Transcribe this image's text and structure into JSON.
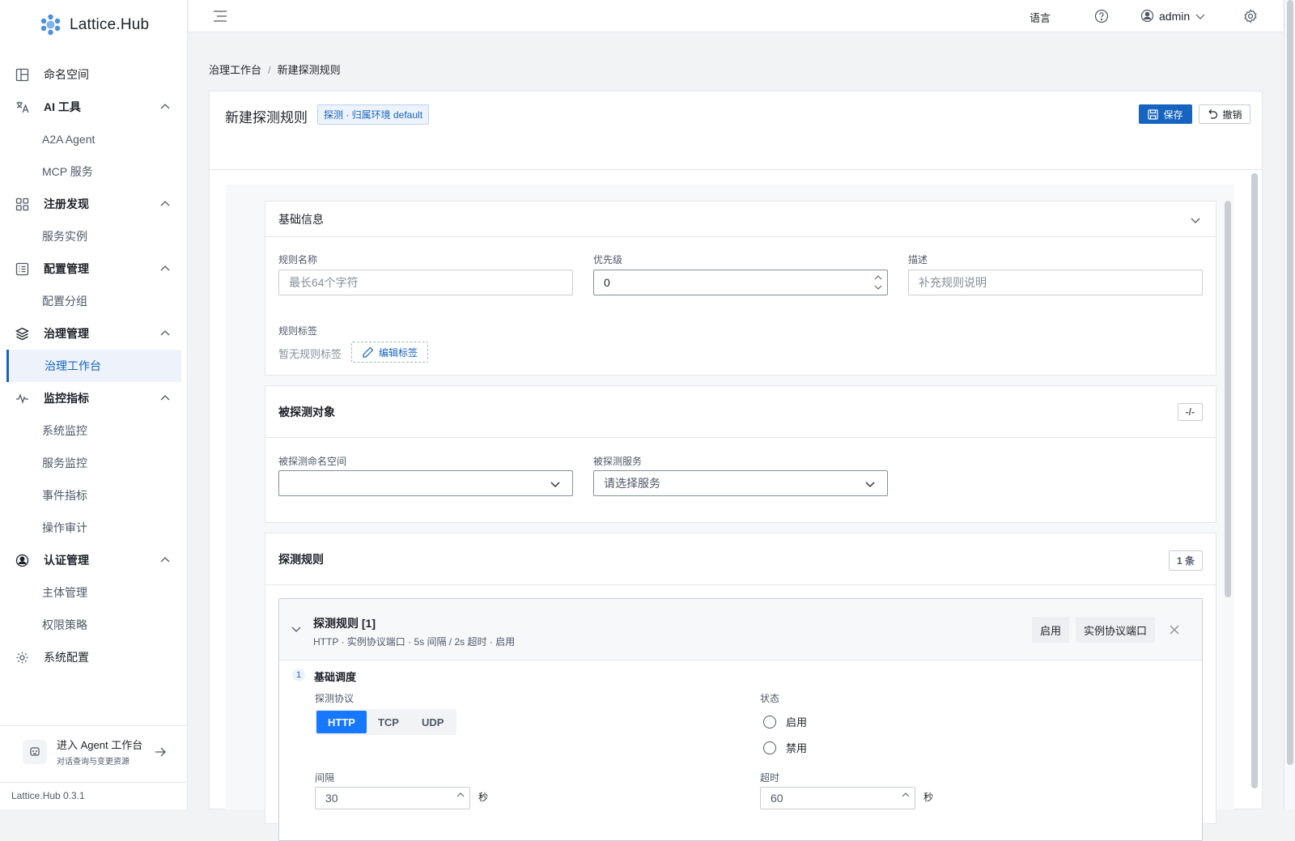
{
  "brand": {
    "name": "Lattice.Hub"
  },
  "sidebar": {
    "items": [
      {
        "label": "命名空间",
        "type": "item",
        "icon": "namespace-icon"
      },
      {
        "label": "AI 工具",
        "type": "group",
        "icon": "translate-icon"
      },
      {
        "label": "A2A Agent",
        "type": "sub"
      },
      {
        "label": "MCP 服务",
        "type": "sub"
      },
      {
        "label": "注册发现",
        "type": "group",
        "icon": "grid-icon"
      },
      {
        "label": "服务实例",
        "type": "sub"
      },
      {
        "label": "配置管理",
        "type": "group",
        "icon": "list-icon"
      },
      {
        "label": "配置分组",
        "type": "sub"
      },
      {
        "label": "治理管理",
        "type": "group",
        "icon": "layers-icon"
      },
      {
        "label": "治理工作台",
        "type": "sub",
        "active": true
      },
      {
        "label": "监控指标",
        "type": "group",
        "icon": "pulse-icon"
      },
      {
        "label": "系统监控",
        "type": "sub"
      },
      {
        "label": "服务监控",
        "type": "sub"
      },
      {
        "label": "事件指标",
        "type": "sub"
      },
      {
        "label": "操作审计",
        "type": "sub"
      },
      {
        "label": "认证管理",
        "type": "group",
        "icon": "user-circle-icon"
      },
      {
        "label": "主体管理",
        "type": "sub"
      },
      {
        "label": "权限策略",
        "type": "sub"
      },
      {
        "label": "系统配置",
        "type": "item",
        "icon": "gear-icon"
      }
    ],
    "agent": {
      "title": "进入 Agent 工作台",
      "subtitle": "对话查询与变更资源"
    },
    "version": "Lattice.Hub 0.3.1"
  },
  "topbar": {
    "language": "语言",
    "user": "admin"
  },
  "breadcrumb": {
    "root": "治理工作台",
    "sep": "/",
    "current": "新建探测规则"
  },
  "page": {
    "title": "新建探测规则",
    "tag": "探测 · 归属环境 default",
    "save": "保存",
    "undo": "撤销"
  },
  "basic": {
    "title": "基础信息",
    "name_label": "规则名称",
    "name_placeholder": "最长64个字符",
    "priority_label": "优先级",
    "priority_value": "0",
    "desc_label": "描述",
    "desc_placeholder": "补充规则说明",
    "tags_label": "规则标签",
    "tags_empty": "暂无规则标签",
    "tags_edit": "编辑标签"
  },
  "target": {
    "title": "被探测对象",
    "badge": "-/-",
    "ns_label": "被探测命名空间",
    "ns_value": "",
    "svc_label": "被探测服务",
    "svc_placeholder": "请选择服务"
  },
  "rules": {
    "title": "探测规则",
    "badge": "1 条",
    "card": {
      "title": "探测规则 [1]",
      "summary": "HTTP · 实例协议端口 · 5s 间隔 / 2s 超时 · 启用",
      "chip_status": "启用",
      "chip_port": "实例协议端口",
      "step_num": "1",
      "step_title": "基础调度",
      "protocol_label": "探测协议",
      "protocols": [
        "HTTP",
        "TCP",
        "UDP"
      ],
      "protocol_selected": "HTTP",
      "status_label": "状态",
      "status_options": [
        "启用",
        "禁用"
      ],
      "interval_label": "间隔",
      "interval_value": "30",
      "interval_unit": "秒",
      "timeout_label": "超时",
      "timeout_value": "60",
      "timeout_unit": "秒"
    }
  }
}
